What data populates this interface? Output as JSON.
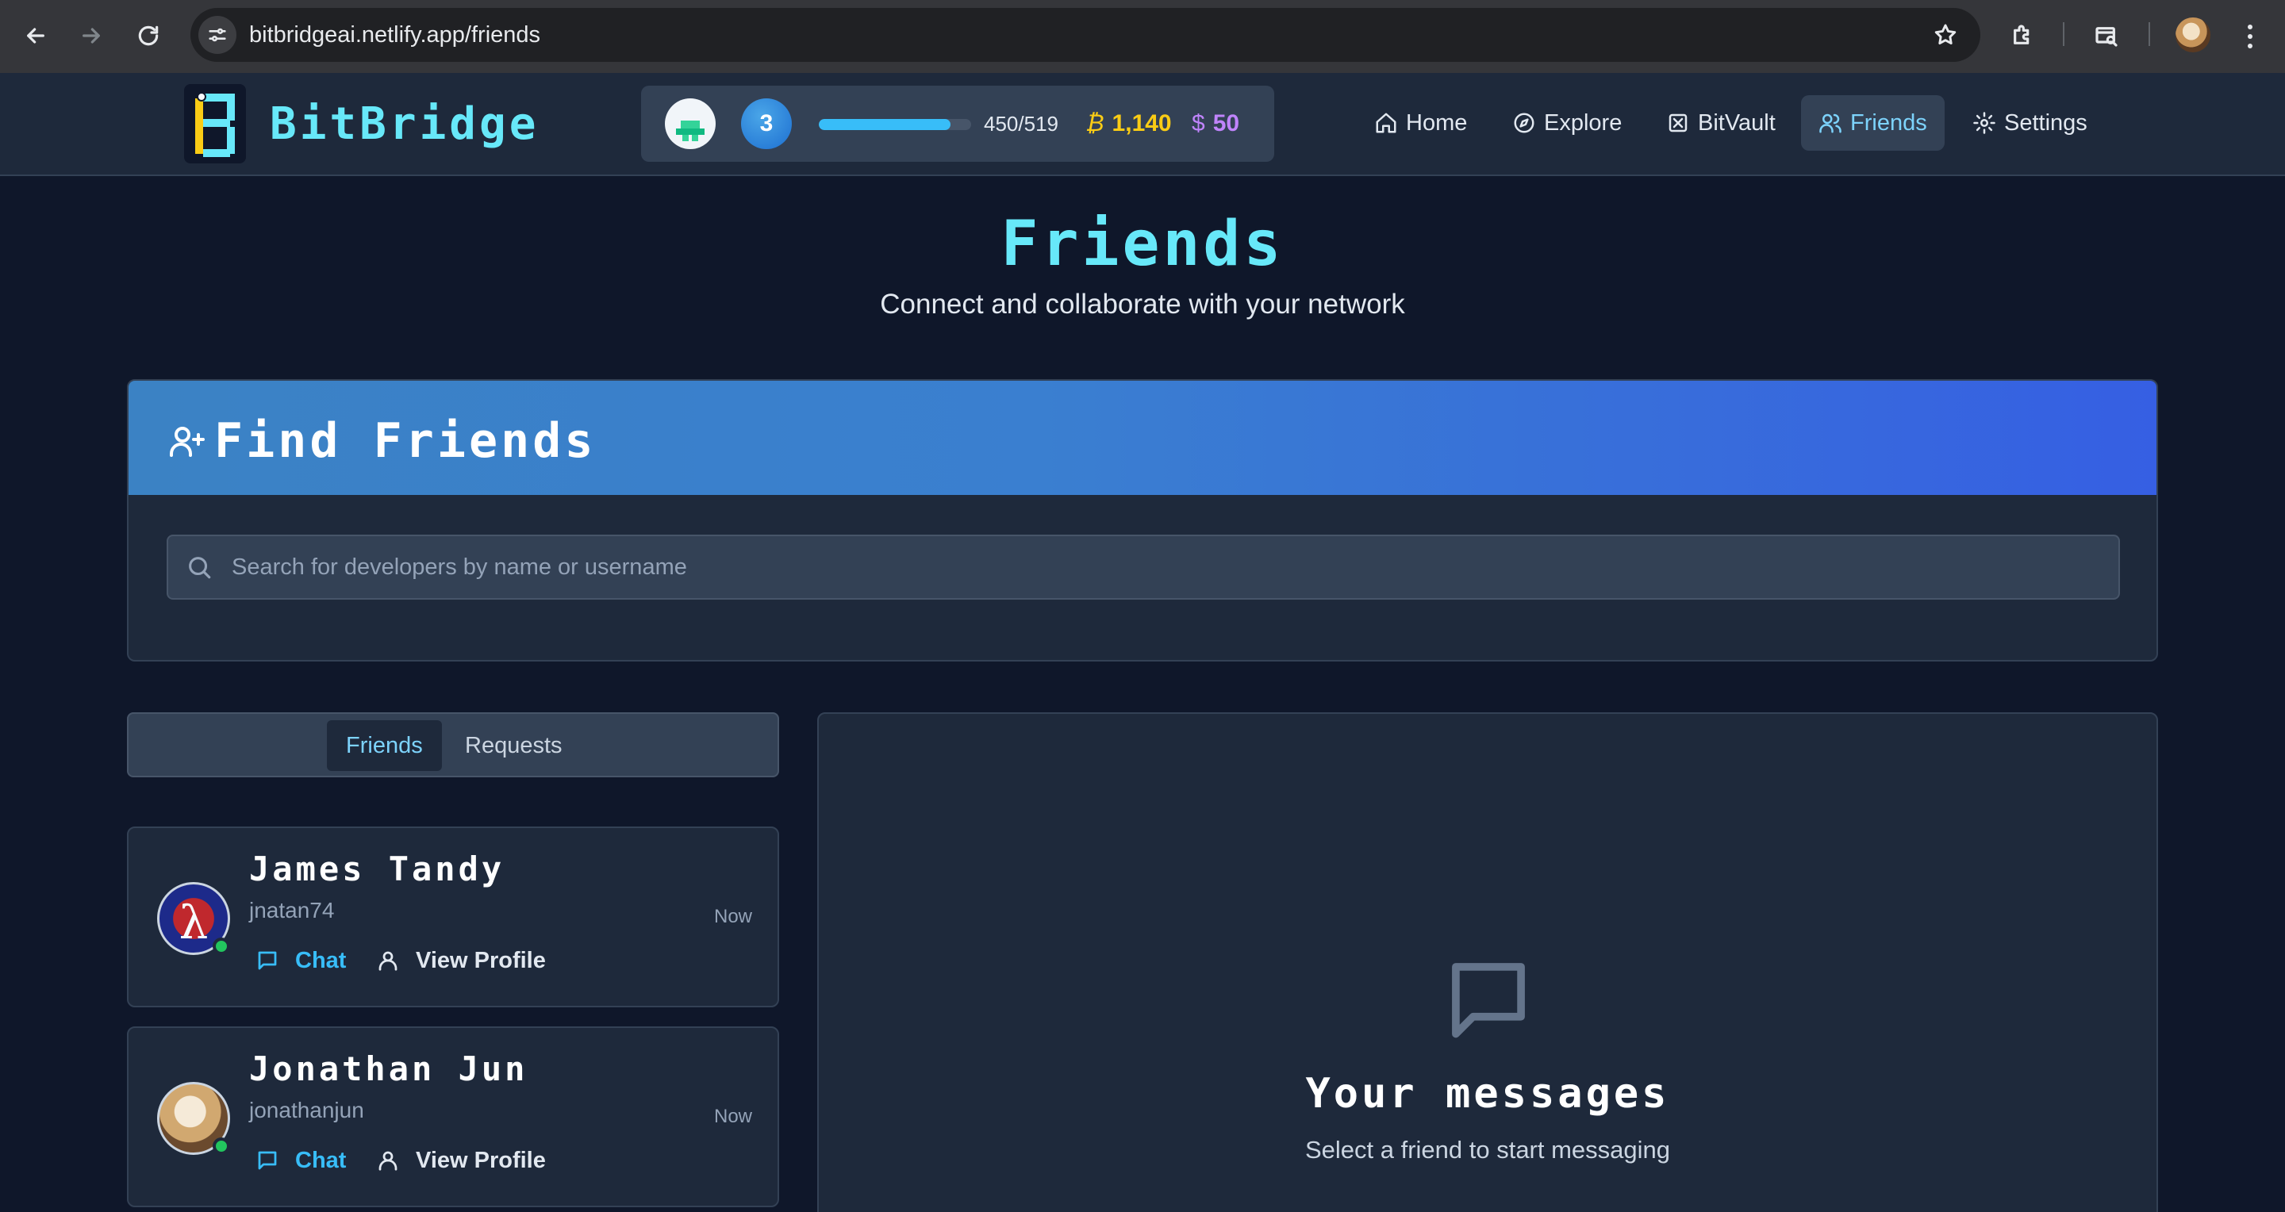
{
  "browser": {
    "url": "bitbridgeai.netlify.app/friends"
  },
  "header": {
    "brand": "BitBridge",
    "stats": {
      "level": "3",
      "xp_text": "450/519",
      "xp_progress": 0.867,
      "btc_symbol": "₿",
      "btc_value": "1,140",
      "usd_symbol": "$",
      "usd_value": "50"
    },
    "nav": [
      {
        "label": "Home",
        "icon": "home-icon"
      },
      {
        "label": "Explore",
        "icon": "compass-icon"
      },
      {
        "label": "BitVault",
        "icon": "vault-icon"
      },
      {
        "label": "Friends",
        "icon": "users-icon",
        "active": true
      },
      {
        "label": "Settings",
        "icon": "gear-icon"
      }
    ]
  },
  "page": {
    "title": "Friends",
    "subtitle": "Connect and collaborate with your network"
  },
  "find_friends": {
    "title": "Find Friends",
    "search_placeholder": "Search for developers by name or username"
  },
  "tabs": [
    {
      "label": "Friends",
      "active": true
    },
    {
      "label": "Requests",
      "active": false
    }
  ],
  "friends": [
    {
      "name": "James Tandy",
      "username": "jnatan74",
      "time": "Now",
      "online": true,
      "chat_label": "Chat",
      "profile_label": "View Profile"
    },
    {
      "name": "Jonathan Jun",
      "username": "jonathanjun",
      "time": "Now",
      "online": true,
      "chat_label": "Chat",
      "profile_label": "View Profile"
    }
  ],
  "messages": {
    "title": "Your messages",
    "subtitle": "Select a friend to start messaging"
  },
  "colors": {
    "accent": "#67e8f9",
    "nav_active": "#7dd3fc",
    "btc": "#facc15",
    "usd": "#c084fc",
    "online": "#22c55e"
  }
}
